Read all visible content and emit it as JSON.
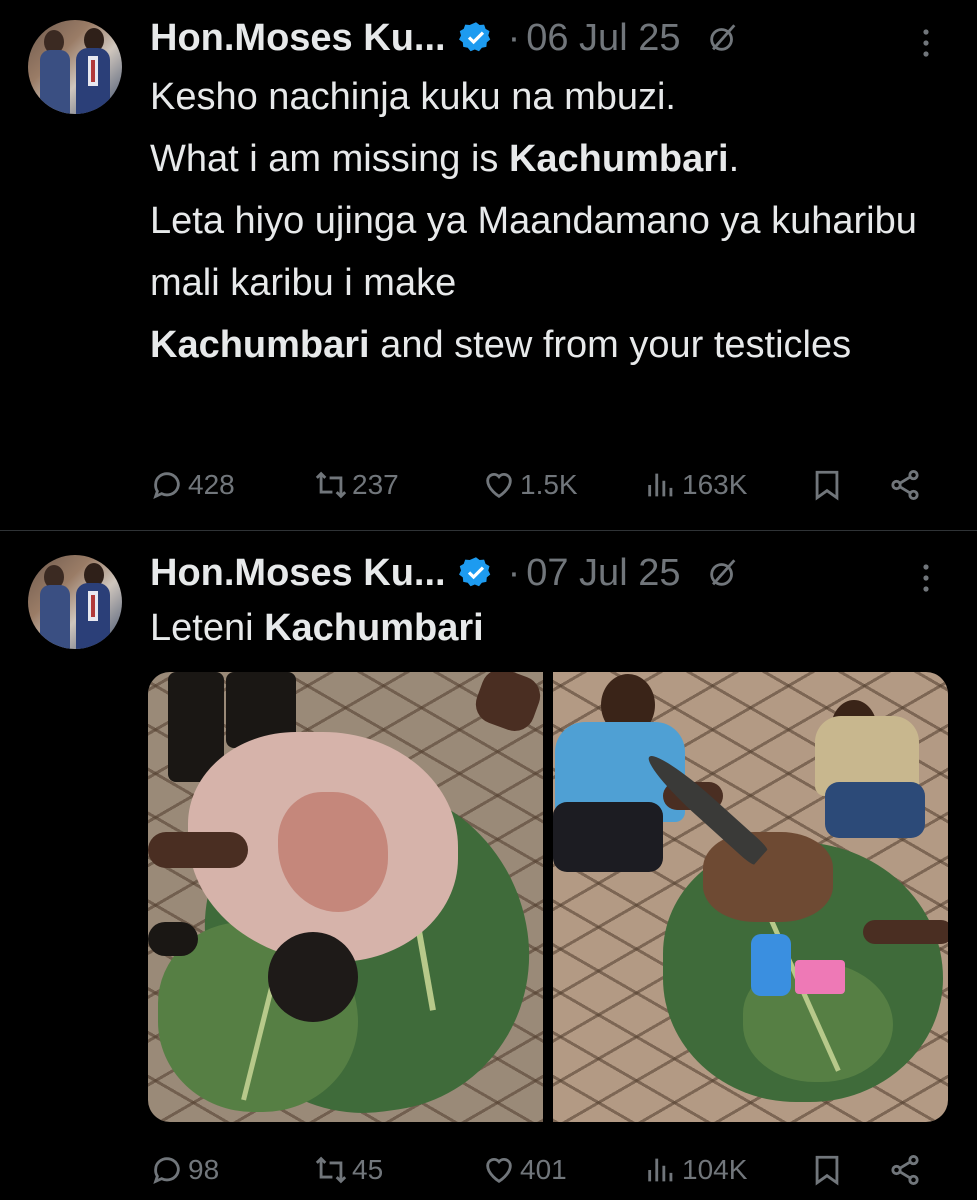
{
  "tweets": [
    {
      "author_name": "Hon.Moses Ku...",
      "separator": "·",
      "date": "06 Jul 25",
      "text_segments": [
        {
          "t": "Kesho nachinja kuku na mbuzi.\nWhat i am missing is ",
          "b": false
        },
        {
          "t": "Kachumbari",
          "b": true
        },
        {
          "t": ".\nLeta hiyo ujinga ya Maandamano ya kuharibu mali karibu i make\n",
          "b": false
        },
        {
          "t": "Kachumbari",
          "b": true
        },
        {
          "t": " and stew from your testicles",
          "b": false
        }
      ],
      "stats": {
        "replies": "428",
        "reposts": "237",
        "likes": "1.5K",
        "views": "163K"
      }
    },
    {
      "author_name": "Hon.Moses Ku...",
      "separator": "·",
      "date": "07 Jul 25",
      "text_segments": [
        {
          "t": "Leteni ",
          "b": false
        },
        {
          "t": "Kachumbari",
          "b": true
        }
      ],
      "stats": {
        "replies": "98",
        "reposts": "45",
        "likes": "401",
        "views": "104K"
      }
    }
  ],
  "icons": {
    "verified": "verified-badge-icon",
    "grok": "grok-icon",
    "more": "more-options-icon",
    "reply": "reply-icon",
    "repost": "repost-icon",
    "like": "like-icon",
    "views": "views-icon",
    "bookmark": "bookmark-icon",
    "share": "share-icon"
  },
  "colors": {
    "background": "#000000",
    "text": "#e7e9ea",
    "muted": "#71767b",
    "verified": "#1d9bf0"
  }
}
